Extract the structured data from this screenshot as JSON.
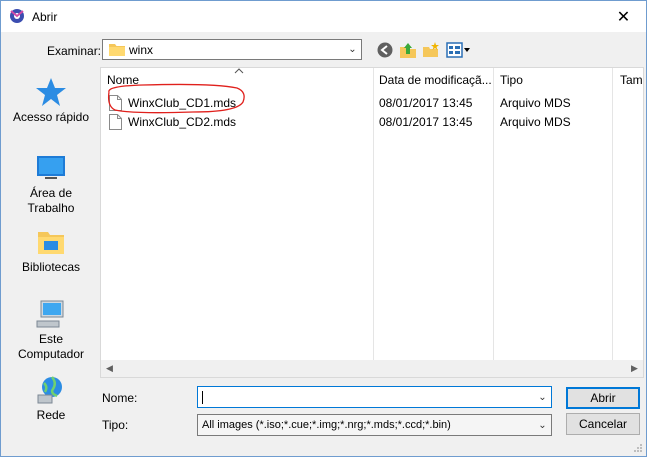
{
  "window": {
    "title": "Abrir",
    "close_glyph": "✕"
  },
  "toolbar": {
    "look_in_label": "Examinar:",
    "folder_name": "winx"
  },
  "places": [
    {
      "label_lines": [
        "Acesso rápido"
      ],
      "icon": "star-icon"
    },
    {
      "label_lines": [
        "Área de",
        "Trabalho"
      ],
      "icon": "desktop-icon"
    },
    {
      "label_lines": [
        "Bibliotecas"
      ],
      "icon": "libraries-icon"
    },
    {
      "label_lines": [
        "Este",
        "Computador"
      ],
      "icon": "computer-icon"
    },
    {
      "label_lines": [
        "Rede"
      ],
      "icon": "network-icon"
    }
  ],
  "columns": {
    "name": "Nome",
    "date": "Data de modificaçã...",
    "type": "Tipo",
    "size": "Tam"
  },
  "files": [
    {
      "name": "WinxClub_CD1.mds",
      "date": "08/01/2017 13:45",
      "type": "Arquivo MDS"
    },
    {
      "name": "WinxClub_CD2.mds",
      "date": "08/01/2017 13:45",
      "type": "Arquivo MDS"
    }
  ],
  "form": {
    "name_label": "Nome:",
    "name_value": "",
    "type_label": "Tipo:",
    "type_value": "All images (*.iso;*.cue;*.img;*.nrg;*.mds;*.ccd;*.bin)"
  },
  "buttons": {
    "open": "Abrir",
    "cancel": "Cancelar"
  },
  "colors": {
    "accent": "#0078d7",
    "annotation": "#e0201c"
  }
}
